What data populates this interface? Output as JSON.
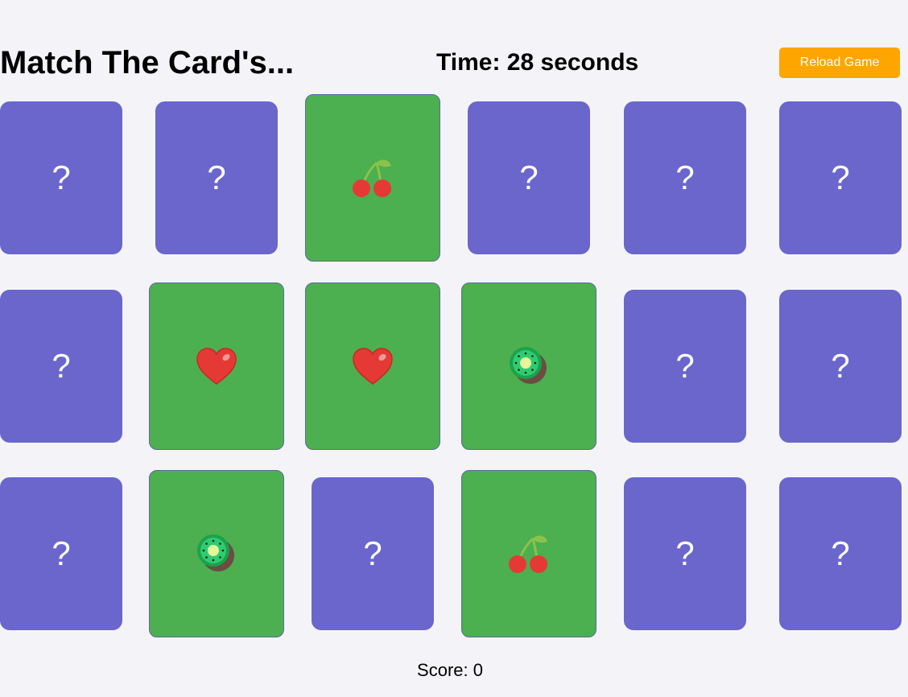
{
  "header": {
    "title": "Match The Card's...",
    "timer": "Time: 28 seconds",
    "reload_label": "Reload Game"
  },
  "cards": [
    {
      "state": "hidden",
      "face": "?"
    },
    {
      "state": "hidden",
      "face": "?"
    },
    {
      "state": "revealed",
      "icon": "cherry-icon"
    },
    {
      "state": "hidden",
      "face": "?"
    },
    {
      "state": "hidden",
      "face": "?"
    },
    {
      "state": "hidden",
      "face": "?"
    },
    {
      "state": "hidden",
      "face": "?"
    },
    {
      "state": "revealed",
      "icon": "heart-icon"
    },
    {
      "state": "revealed",
      "icon": "heart-icon"
    },
    {
      "state": "revealed",
      "icon": "kiwi-icon"
    },
    {
      "state": "hidden",
      "face": "?"
    },
    {
      "state": "hidden",
      "face": "?"
    },
    {
      "state": "hidden",
      "face": "?"
    },
    {
      "state": "revealed",
      "icon": "kiwi-icon"
    },
    {
      "state": "hidden",
      "face": "?"
    },
    {
      "state": "revealed",
      "icon": "cherry-icon"
    },
    {
      "state": "hidden",
      "face": "?"
    },
    {
      "state": "hidden",
      "face": "?"
    }
  ],
  "footer": {
    "score": "Score: 0"
  },
  "colors": {
    "card_back": "#6a66cc",
    "card_revealed": "#4caf50",
    "reload_button": "#ffa500",
    "background": "#f4f4f8"
  }
}
